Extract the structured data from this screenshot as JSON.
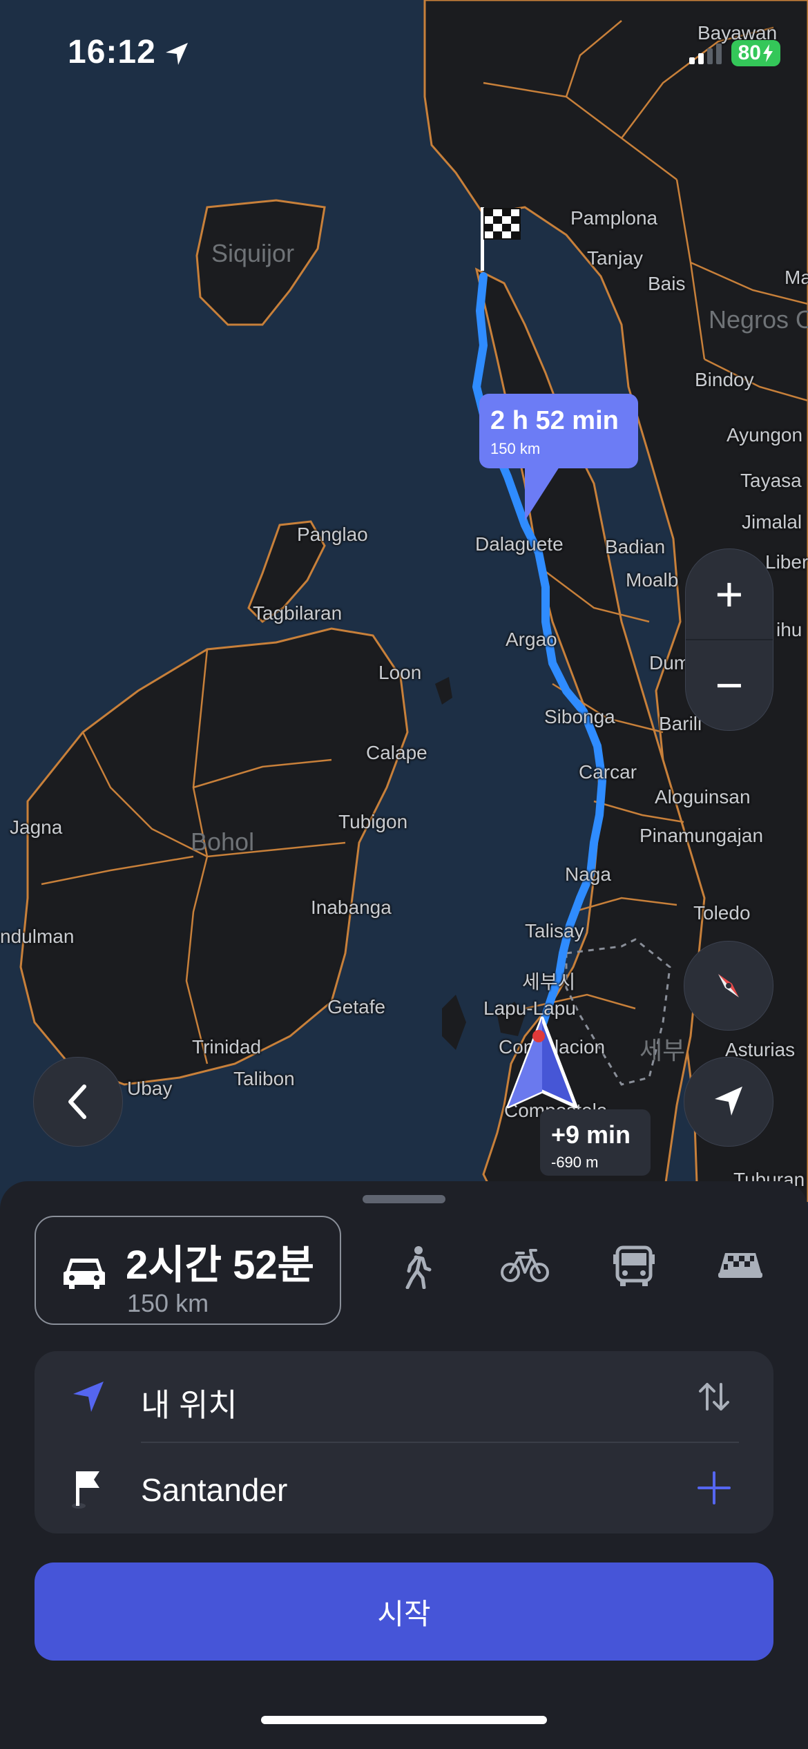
{
  "status_bar": {
    "time": "16:12",
    "battery": "80",
    "icons": [
      "location-arrow-icon",
      "cellular-signal-icon",
      "battery-charging-icon"
    ]
  },
  "map": {
    "places": [
      {
        "name": "Bayawan",
        "kind": "city"
      },
      {
        "name": "Pamplona",
        "kind": "city"
      },
      {
        "name": "Tanjay",
        "kind": "city"
      },
      {
        "name": "Bais",
        "kind": "city"
      },
      {
        "name": "Siquijor",
        "kind": "region"
      },
      {
        "name": "Negros O",
        "kind": "region"
      },
      {
        "name": "Bindoy",
        "kind": "city"
      },
      {
        "name": "Ayungon",
        "kind": "city"
      },
      {
        "name": "Tayasa",
        "kind": "city"
      },
      {
        "name": "Jimalal",
        "kind": "city"
      },
      {
        "name": "Liber",
        "kind": "city"
      },
      {
        "name": "Panglao",
        "kind": "city"
      },
      {
        "name": "Dalaguete",
        "kind": "city"
      },
      {
        "name": "Badian",
        "kind": "city"
      },
      {
        "name": "Moalb",
        "kind": "city"
      },
      {
        "name": "Tagbilaran",
        "kind": "city"
      },
      {
        "name": "Argao",
        "kind": "city"
      },
      {
        "name": "Loon",
        "kind": "city"
      },
      {
        "name": "Dum",
        "kind": "city"
      },
      {
        "name": "Sibonga",
        "kind": "city"
      },
      {
        "name": "Barili",
        "kind": "city"
      },
      {
        "name": "Calape",
        "kind": "city"
      },
      {
        "name": "Carcar",
        "kind": "city"
      },
      {
        "name": "Aloguinsan",
        "kind": "city"
      },
      {
        "name": "Jagna",
        "kind": "city"
      },
      {
        "name": "Bohol",
        "kind": "region"
      },
      {
        "name": "Tubigon",
        "kind": "city"
      },
      {
        "name": "Pinamungajan",
        "kind": "city"
      },
      {
        "name": "Naga",
        "kind": "city"
      },
      {
        "name": "Toledo",
        "kind": "city"
      },
      {
        "name": "Inabanga",
        "kind": "city"
      },
      {
        "name": "ndulman",
        "kind": "city"
      },
      {
        "name": "Talisay",
        "kind": "city"
      },
      {
        "name": "세부시",
        "kind": "city"
      },
      {
        "name": "Lapu-Lapu",
        "kind": "city"
      },
      {
        "name": "Getafe",
        "kind": "city"
      },
      {
        "name": "Consolacion",
        "kind": "city"
      },
      {
        "name": "세부",
        "kind": "region"
      },
      {
        "name": "Asturias",
        "kind": "city"
      },
      {
        "name": "Trinidad",
        "kind": "city"
      },
      {
        "name": "Talibon",
        "kind": "city"
      },
      {
        "name": "Ubay",
        "kind": "city"
      },
      {
        "name": "Compostela",
        "kind": "city"
      },
      {
        "name": "Tuburan",
        "kind": "city"
      },
      {
        "name": "Ma",
        "kind": "city"
      },
      {
        "name": "ihu",
        "kind": "city"
      }
    ],
    "route_eta": {
      "duration": "2 h 52 min",
      "distance": "150 km"
    },
    "alt_route": {
      "delta": "+9 min",
      "distance": "-690 m"
    },
    "controls": {
      "zoom_in_label": "+",
      "zoom_out_label": "−",
      "icons": [
        "compass-icon",
        "my-location-icon",
        "back-chevron-icon"
      ]
    }
  },
  "sheet": {
    "selected_mode": {
      "icon": "car-icon",
      "duration": "2시간 52분",
      "distance": "150 km"
    },
    "other_modes": [
      "walk-icon",
      "bicycle-icon",
      "bus-icon",
      "taxi-icon"
    ],
    "route": {
      "origin": "내 위치",
      "destination": "Santander",
      "swap_icon": "swap-icon",
      "add_icon": "plus-icon"
    },
    "start_label": "시작"
  },
  "colors": {
    "water": "#1d2f45",
    "land": "#1b1c1f",
    "border": "#c8803a",
    "route": "#2f8cff",
    "accent": "#4655d8",
    "bubble": "#6c7cf5",
    "battery": "#34c759",
    "sheet": "#1e2027"
  }
}
